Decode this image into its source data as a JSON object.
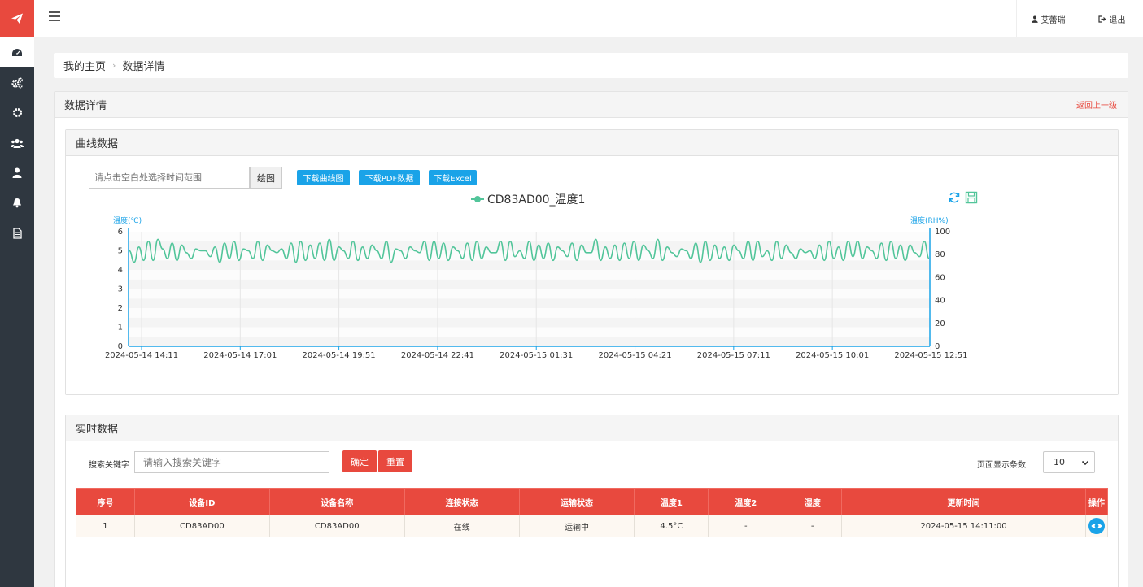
{
  "header": {
    "user_name": "艾蕾瑞",
    "logout_label": "退出"
  },
  "breadcrumb": {
    "home": "我的主页",
    "current": "数据详情"
  },
  "panel": {
    "title": "数据详情",
    "back_label": "返回上一级"
  },
  "curve_section": {
    "title": "曲线数据",
    "range_placeholder": "请点击空白处选择时间范围",
    "draw_label": "绘图",
    "download_chart_label": "下载曲线图",
    "download_pdf_label": "下载PDF数据",
    "download_excel_label": "下载Excel"
  },
  "chart_data": {
    "type": "line",
    "legend": "CD83AD00_温度1",
    "legend_placement": "top-center",
    "ylabel_left": "温度(℃)",
    "ylabel_right": "温度(RH%)",
    "ylim_left": [
      0,
      6
    ],
    "ylim_right": [
      0,
      100
    ],
    "yticks_left": [
      "0",
      "1",
      "2",
      "3",
      "4",
      "5",
      "6"
    ],
    "yticks_right": [
      "0",
      "20",
      "40",
      "60",
      "80",
      "100"
    ],
    "x_ticks": [
      "2024-05-14 14:11",
      "2024-05-14 17:01",
      "2024-05-14 19:51",
      "2024-05-14 22:41",
      "2024-05-15 01:31",
      "2024-05-15 04:21",
      "2024-05-15 07:11",
      "2024-05-15 10:01",
      "2024-05-15 12:51"
    ],
    "series": [
      {
        "name": "CD83AD00_温度1",
        "color": "#52c59a",
        "values": [
          5.0,
          4.4,
          5.2,
          4.5,
          5.5,
          4.5,
          5.6,
          5.1,
          4.6,
          5.4,
          4.5,
          5.3,
          4.9,
          4.6,
          5.1,
          5.0,
          5.0,
          4.7,
          5.2,
          4.4,
          5.4,
          4.6,
          5.5,
          4.5,
          5.1,
          5.0,
          4.6,
          5.5,
          4.5,
          5.3,
          5.0,
          4.9,
          5.1,
          4.6,
          5.4,
          4.4,
          5.5,
          4.5,
          5.3,
          4.6,
          5.4,
          4.5,
          5.6,
          4.5,
          5.2,
          5.0,
          4.6,
          5.5,
          4.5,
          5.2,
          4.6,
          5.3,
          5.0,
          4.6,
          5.5,
          4.4,
          5.1,
          5.0,
          4.6,
          5.2,
          5.0,
          4.9,
          5.5,
          4.5,
          5.5,
          4.6,
          5.4,
          4.5,
          5.2,
          5.0,
          4.6,
          5.4,
          4.5,
          5.5,
          4.6,
          5.2,
          4.9,
          4.9,
          5.5,
          4.5,
          5.5,
          4.7,
          5.0,
          4.6,
          5.5,
          4.5,
          5.3,
          4.6,
          5.4,
          4.5,
          5.2,
          5.0,
          4.7,
          5.4,
          4.5,
          5.3,
          4.9,
          4.9,
          5.6,
          4.5,
          5.2,
          4.6,
          5.3,
          4.5,
          5.4,
          4.6,
          5.5,
          4.5,
          5.3,
          5.0,
          4.6,
          5.6,
          4.5,
          5.2,
          4.9,
          4.7,
          5.1,
          5.0,
          4.6,
          5.4,
          4.4,
          5.5,
          4.5,
          5.3,
          4.6,
          5.2,
          4.5,
          5.3,
          5.0,
          4.6,
          5.5,
          4.5,
          5.5,
          4.7,
          5.0,
          4.5,
          5.5,
          4.6,
          5.3,
          4.9,
          4.6,
          5.1,
          4.9,
          5.0,
          4.6,
          5.3,
          4.5,
          5.5,
          4.6,
          5.2,
          4.5,
          5.5,
          4.7,
          5.5,
          4.6,
          5.2,
          5.0,
          4.6,
          5.4,
          4.5,
          5.5,
          4.6,
          5.3,
          4.5,
          5.3,
          4.9,
          4.7,
          5.5,
          4.6
        ]
      }
    ],
    "grid": true
  },
  "realtime_section": {
    "title": "实时数据",
    "search_label": "搜索关键字",
    "search_placeholder": "请输入搜索关键字",
    "confirm_label": "确定",
    "reset_label": "重置",
    "page_size_label": "页面显示条数",
    "page_size_value": "10",
    "columns": [
      "序号",
      "设备ID",
      "设备名称",
      "连接状态",
      "运输状态",
      "温度1",
      "温度2",
      "湿度",
      "更新时间",
      "操作"
    ],
    "rows": [
      [
        "1",
        "CD83AD00",
        "CD83AD00",
        "在线",
        "运输中",
        "4.5°C",
        "-",
        "-",
        "2024-05-15 14:11:00"
      ]
    ]
  },
  "colors": {
    "sidebar_bg": "#2f3740",
    "accent_red": "#e8493e",
    "accent_blue": "#1aa3e8",
    "series_green": "#52c59a"
  },
  "icons": {
    "logo": "paper-plane-icon",
    "nav": [
      "dashboard-icon",
      "cogs-icon",
      "gear-icon",
      "users-icon",
      "user-icon",
      "bell-icon",
      "document-icon"
    ],
    "chart_tools": [
      "refresh-icon",
      "save-icon"
    ],
    "row_action": "eye-icon"
  }
}
